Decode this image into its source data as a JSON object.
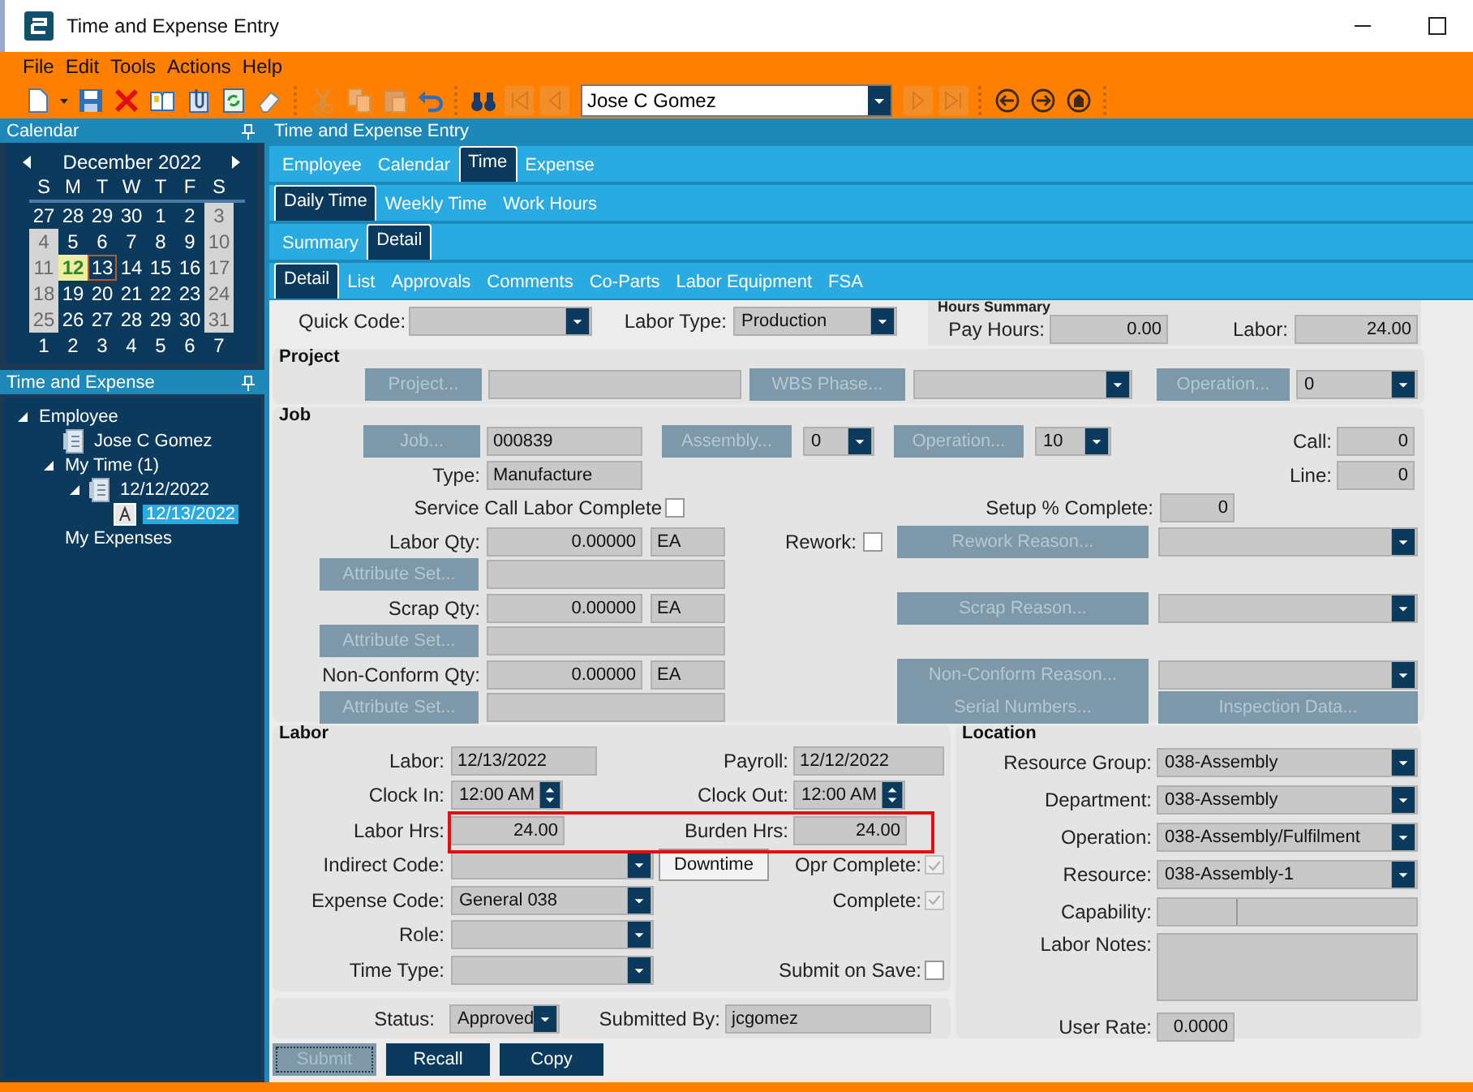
{
  "window": {
    "title": "Time and Expense Entry"
  },
  "menu": [
    "File",
    "Edit",
    "Tools",
    "Actions",
    "Help"
  ],
  "toolbar": {
    "buttons_left": [
      {
        "kind": "new",
        "disabled": false
      },
      {
        "kind": "caret",
        "disabled": false
      },
      {
        "kind": "save",
        "disabled": false
      },
      {
        "kind": "delete",
        "disabled": false
      },
      {
        "kind": "book",
        "disabled": false
      },
      {
        "kind": "clip",
        "disabled": false
      },
      {
        "kind": "refresh",
        "disabled": false
      },
      {
        "kind": "eraser",
        "disabled": false
      },
      {
        "kind": "sep"
      },
      {
        "kind": "cut",
        "disabled": true
      },
      {
        "kind": "copy",
        "disabled": true
      },
      {
        "kind": "paste",
        "disabled": true
      },
      {
        "kind": "undo",
        "disabled": false
      },
      {
        "kind": "sep"
      },
      {
        "kind": "search",
        "disabled": false
      },
      {
        "kind": "first",
        "disabled": true
      },
      {
        "kind": "prev",
        "disabled": true
      }
    ],
    "employee": "Jose C Gomez",
    "buttons_right": [
      {
        "kind": "next",
        "disabled": true
      },
      {
        "kind": "last",
        "disabled": true
      },
      {
        "kind": "sep"
      },
      {
        "kind": "back",
        "disabled": false
      },
      {
        "kind": "forward",
        "disabled": false
      },
      {
        "kind": "home",
        "disabled": false
      },
      {
        "kind": "sep"
      }
    ]
  },
  "calendar": {
    "title": "Calendar",
    "month": "December 2022",
    "weekdays": [
      "S",
      "M",
      "T",
      "W",
      "T",
      "F",
      "S"
    ],
    "weeks": [
      [
        {
          "d": "27",
          "dimmed": false,
          "selected": false,
          "today": false
        },
        {
          "d": "28",
          "dimmed": false,
          "selected": false,
          "today": false
        },
        {
          "d": "29",
          "dimmed": false,
          "selected": false,
          "today": false
        },
        {
          "d": "30",
          "dimmed": false,
          "selected": false,
          "today": false
        },
        {
          "d": "1",
          "dimmed": false,
          "selected": false,
          "today": false
        },
        {
          "d": "2",
          "dimmed": false,
          "selected": false,
          "today": false
        },
        {
          "d": "3",
          "dimmed": true,
          "selected": false,
          "today": false
        }
      ],
      [
        {
          "d": "4",
          "dimmed": true,
          "selected": false,
          "today": false
        },
        {
          "d": "5",
          "dimmed": false,
          "selected": false,
          "today": false
        },
        {
          "d": "6",
          "dimmed": false,
          "selected": false,
          "today": false
        },
        {
          "d": "7",
          "dimmed": false,
          "selected": false,
          "today": false
        },
        {
          "d": "8",
          "dimmed": false,
          "selected": false,
          "today": false
        },
        {
          "d": "9",
          "dimmed": false,
          "selected": false,
          "today": false
        },
        {
          "d": "10",
          "dimmed": true,
          "selected": false,
          "today": false
        }
      ],
      [
        {
          "d": "11",
          "dimmed": true,
          "selected": false,
          "today": false
        },
        {
          "d": "12",
          "dimmed": false,
          "selected": true,
          "today": false
        },
        {
          "d": "13",
          "dimmed": false,
          "selected": false,
          "today": true
        },
        {
          "d": "14",
          "dimmed": false,
          "selected": false,
          "today": false
        },
        {
          "d": "15",
          "dimmed": false,
          "selected": false,
          "today": false
        },
        {
          "d": "16",
          "dimmed": false,
          "selected": false,
          "today": false
        },
        {
          "d": "17",
          "dimmed": true,
          "selected": false,
          "today": false
        }
      ],
      [
        {
          "d": "18",
          "dimmed": true,
          "selected": false,
          "today": false
        },
        {
          "d": "19",
          "dimmed": false,
          "selected": false,
          "today": false
        },
        {
          "d": "20",
          "dimmed": false,
          "selected": false,
          "today": false
        },
        {
          "d": "21",
          "dimmed": false,
          "selected": false,
          "today": false
        },
        {
          "d": "22",
          "dimmed": false,
          "selected": false,
          "today": false
        },
        {
          "d": "23",
          "dimmed": false,
          "selected": false,
          "today": false
        },
        {
          "d": "24",
          "dimmed": true,
          "selected": false,
          "today": false
        }
      ],
      [
        {
          "d": "25",
          "dimmed": true,
          "selected": false,
          "today": false
        },
        {
          "d": "26",
          "dimmed": false,
          "selected": false,
          "today": false
        },
        {
          "d": "27",
          "dimmed": false,
          "selected": false,
          "today": false
        },
        {
          "d": "28",
          "dimmed": false,
          "selected": false,
          "today": false
        },
        {
          "d": "29",
          "dimmed": false,
          "selected": false,
          "today": false
        },
        {
          "d": "30",
          "dimmed": false,
          "selected": false,
          "today": false
        },
        {
          "d": "31",
          "dimmed": true,
          "selected": false,
          "today": false
        }
      ],
      [
        {
          "d": "1",
          "dimmed": false,
          "selected": false,
          "today": false
        },
        {
          "d": "2",
          "dimmed": false,
          "selected": false,
          "today": false
        },
        {
          "d": "3",
          "dimmed": false,
          "selected": false,
          "today": false
        },
        {
          "d": "4",
          "dimmed": false,
          "selected": false,
          "today": false
        },
        {
          "d": "5",
          "dimmed": false,
          "selected": false,
          "today": false
        },
        {
          "d": "6",
          "dimmed": false,
          "selected": false,
          "today": false
        },
        {
          "d": "7",
          "dimmed": false,
          "selected": false,
          "today": false
        }
      ]
    ]
  },
  "tree": {
    "title": "Time and Expense",
    "items": [
      {
        "label": "Employee",
        "expanded": true,
        "selected": false,
        "children": [
          {
            "label": "Jose C Gomez",
            "kind": "person",
            "selected": false
          },
          {
            "label": "My Time (1)",
            "expanded": true,
            "selected": false,
            "children": [
              {
                "label": "12/12/2022",
                "kind": "sheet",
                "expanded": true,
                "selected": false,
                "children": [
                  {
                    "label": "12/13/2022",
                    "kind": "entry",
                    "selected": true
                  }
                ]
              }
            ]
          },
          {
            "label": "My Expenses",
            "selected": false
          }
        ]
      }
    ]
  },
  "panel": {
    "title": "Time and Expense Entry"
  },
  "tab_rows": [
    [
      {
        "label": "Employee",
        "selected": false
      },
      {
        "label": "Calendar",
        "selected": false
      },
      {
        "label": "Time",
        "selected": true
      },
      {
        "label": "Expense",
        "selected": false
      }
    ],
    [
      {
        "label": "Daily Time",
        "selected": true
      },
      {
        "label": "Weekly Time",
        "selected": false
      },
      {
        "label": "Work Hours",
        "selected": false
      }
    ],
    [
      {
        "label": "Summary",
        "selected": false
      },
      {
        "label": "Detail",
        "selected": true
      }
    ],
    [
      {
        "label": "Detail",
        "selected": true
      },
      {
        "label": "List",
        "selected": false
      },
      {
        "label": "Approvals",
        "selected": false
      },
      {
        "label": "Comments",
        "selected": false
      },
      {
        "label": "Co-Parts",
        "selected": false
      },
      {
        "label": "Labor Equipment",
        "selected": false
      },
      {
        "label": "FSA",
        "selected": false
      }
    ]
  ],
  "top": {
    "items": [
      {
        "kind": "label",
        "text": "Quick Code:"
      },
      {
        "kind": "combo"
      },
      {
        "kind": "label",
        "text": "Labor Type:"
      },
      {
        "kind": "combo",
        "value": "Production"
      }
    ]
  },
  "hours_summary": {
    "title": "Hours Summary",
    "items": [
      {
        "kind": "label",
        "text": "Pay Hours:"
      },
      {
        "kind": "number",
        "value": "0.00"
      },
      {
        "kind": "label",
        "text": "Labor:"
      },
      {
        "kind": "number",
        "value": "24.00"
      }
    ]
  },
  "project": {
    "title": "Project",
    "items": [
      {
        "kind": "button",
        "text": "Project...",
        "disabled": true
      },
      {
        "kind": "field"
      },
      {
        "kind": "button",
        "text": "WBS Phase...",
        "disabled": true
      },
      {
        "kind": "combo"
      },
      {
        "kind": "button",
        "text": "Operation...",
        "disabled": true
      },
      {
        "kind": "combo",
        "value": "0"
      }
    ]
  },
  "job": {
    "title": "Job",
    "rows": [
      {
        "items": [
          {
            "kind": "button",
            "text": "Job...",
            "disabled": true
          },
          {
            "kind": "field",
            "value": "000839"
          },
          {
            "kind": "button",
            "text": "Assembly...",
            "disabled": true
          },
          {
            "kind": "combo",
            "value": "0"
          },
          {
            "kind": "button",
            "text": "Operation...",
            "disabled": true
          },
          {
            "kind": "combo",
            "value": "10"
          },
          {
            "kind": "label",
            "text": "Call:"
          },
          {
            "kind": "number",
            "value": "0"
          }
        ]
      },
      {
        "items": [
          {
            "kind": "label",
            "text": "Type:"
          },
          {
            "kind": "field",
            "value": "Manufacture"
          },
          {
            "kind": "label",
            "text": "Line:"
          },
          {
            "kind": "number",
            "value": "0"
          }
        ]
      },
      {
        "items": [
          {
            "kind": "label",
            "text": "Service Call Labor Complete"
          },
          {
            "kind": "check",
            "checked": false,
            "disabled": false
          },
          {
            "kind": "label",
            "text": "Setup % Complete:"
          },
          {
            "kind": "number",
            "value": "0"
          }
        ]
      },
      {
        "items": [
          {
            "kind": "label",
            "text": "Labor Qty:"
          },
          {
            "kind": "number",
            "value": "0.00000"
          },
          {
            "kind": "field",
            "value": "EA"
          },
          {
            "kind": "label",
            "text": "Rework:"
          },
          {
            "kind": "check",
            "checked": false,
            "disabled": false
          },
          {
            "kind": "button",
            "text": "Rework Reason...",
            "disabled": true
          },
          {
            "kind": "combo"
          }
        ]
      },
      {
        "items": [
          {
            "kind": "button",
            "text": "Attribute Set...",
            "disabled": true
          },
          {
            "kind": "field"
          }
        ]
      },
      {
        "items": [
          {
            "kind": "label",
            "text": "Scrap Qty:"
          },
          {
            "kind": "number",
            "value": "0.00000"
          },
          {
            "kind": "field",
            "value": "EA"
          },
          {
            "kind": "button",
            "text": "Scrap Reason...",
            "disabled": true
          },
          {
            "kind": "combo"
          }
        ]
      },
      {
        "items": [
          {
            "kind": "button",
            "text": "Attribute Set...",
            "disabled": true
          },
          {
            "kind": "field"
          }
        ]
      },
      {
        "items": [
          {
            "kind": "label",
            "text": "Non-Conform Qty:"
          },
          {
            "kind": "number",
            "value": "0.00000"
          },
          {
            "kind": "field",
            "value": "EA"
          },
          {
            "kind": "button",
            "text": "Non-Conform Reason...",
            "disabled": true
          },
          {
            "kind": "combo"
          }
        ]
      },
      {
        "items": [
          {
            "kind": "button",
            "text": "Attribute Set...",
            "disabled": true
          },
          {
            "kind": "field"
          },
          {
            "kind": "button",
            "text": "Serial Numbers...",
            "disabled": true
          },
          {
            "kind": "button",
            "text": "Inspection Data...",
            "disabled": true
          }
        ]
      }
    ]
  },
  "labor": {
    "title": "Labor",
    "highlighted": true,
    "rows": [
      {
        "items": [
          {
            "kind": "label",
            "text": "Labor:"
          },
          {
            "kind": "field",
            "value": "12/13/2022"
          },
          {
            "kind": "label",
            "text": "Payroll:"
          },
          {
            "kind": "field",
            "value": "12/12/2022"
          }
        ]
      },
      {
        "items": [
          {
            "kind": "label",
            "text": "Clock In:"
          },
          {
            "kind": "spin",
            "value": "12:00 AM"
          },
          {
            "kind": "label",
            "text": "Clock Out:"
          },
          {
            "kind": "spin",
            "value": "12:00 AM"
          }
        ]
      },
      {
        "items": [
          {
            "kind": "label",
            "text": "Labor Hrs:"
          },
          {
            "kind": "number",
            "value": "24.00"
          },
          {
            "kind": "label",
            "text": "Burden Hrs:"
          },
          {
            "kind": "number",
            "value": "24.00"
          }
        ]
      },
      {
        "items": [
          {
            "kind": "label",
            "text": "Indirect Code:"
          },
          {
            "kind": "combo"
          },
          {
            "kind": "button",
            "text": "Downtime",
            "disabled": false
          },
          {
            "kind": "label",
            "text": "Opr Complete:"
          },
          {
            "kind": "check",
            "checked": true,
            "disabled": true
          }
        ]
      },
      {
        "items": [
          {
            "kind": "label",
            "text": "Expense Code:"
          },
          {
            "kind": "combo",
            "value": "General 038"
          },
          {
            "kind": "label",
            "text": "Complete:"
          },
          {
            "kind": "check",
            "checked": true,
            "disabled": true
          }
        ]
      },
      {
        "items": [
          {
            "kind": "label",
            "text": "Role:"
          },
          {
            "kind": "combo"
          }
        ]
      },
      {
        "items": [
          {
            "kind": "label",
            "text": "Time Type:"
          },
          {
            "kind": "combo"
          },
          {
            "kind": "label",
            "text": "Submit on Save:"
          },
          {
            "kind": "check",
            "checked": false,
            "disabled": false
          }
        ]
      }
    ]
  },
  "location": {
    "title": "Location",
    "rows": [
      {
        "items": [
          {
            "kind": "label",
            "text": "Resource Group:"
          },
          {
            "kind": "combo",
            "value": "038-Assembly"
          }
        ]
      },
      {
        "items": [
          {
            "kind": "label",
            "text": "Department:"
          },
          {
            "kind": "combo",
            "value": "038-Assembly"
          }
        ]
      },
      {
        "items": [
          {
            "kind": "label",
            "text": "Operation:"
          },
          {
            "kind": "combo",
            "value": "038-Assembly/Fulfilment"
          }
        ]
      },
      {
        "items": [
          {
            "kind": "label",
            "text": "Resource:"
          },
          {
            "kind": "combo",
            "value": "038-Assembly-1"
          }
        ]
      },
      {
        "items": [
          {
            "kind": "label",
            "text": "Capability:"
          },
          {
            "kind": "dual"
          }
        ]
      },
      {
        "items": [
          {
            "kind": "label",
            "text": "Labor Notes:"
          },
          {
            "kind": "area"
          }
        ]
      },
      {
        "items": [
          {
            "kind": "label",
            "text": "User Rate:"
          },
          {
            "kind": "number",
            "value": "0.0000"
          }
        ]
      }
    ]
  },
  "status_row": {
    "items": [
      {
        "kind": "label",
        "text": "Status:"
      },
      {
        "kind": "combo",
        "value": "Approved"
      },
      {
        "kind": "label",
        "text": "Submitted By:"
      },
      {
        "kind": "field",
        "value": "jcgomez"
      }
    ]
  },
  "actions": [
    {
      "label": "Submit",
      "disabled": true
    },
    {
      "label": "Recall",
      "disabled": false
    },
    {
      "label": "Copy",
      "disabled": false
    }
  ]
}
